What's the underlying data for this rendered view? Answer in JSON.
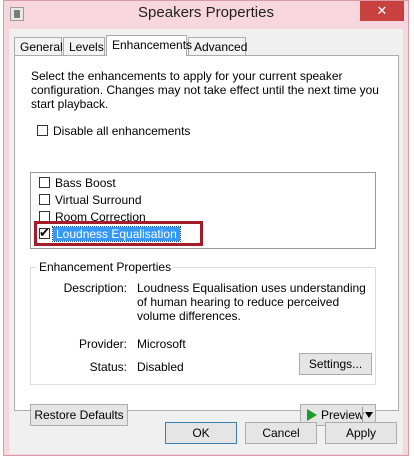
{
  "window": {
    "title": "Speakers Properties",
    "close_glyph": "✕"
  },
  "tabs": [
    {
      "label": "General"
    },
    {
      "label": "Levels"
    },
    {
      "label": "Enhancements"
    },
    {
      "label": "Advanced"
    }
  ],
  "enhancements": {
    "intro": "Select the enhancements to apply for your current speaker configuration. Changes may not take effect until the next time you start playback.",
    "disable_all_label": "Disable all enhancements",
    "disable_all_checked": false,
    "list": [
      {
        "label": "Bass Boost",
        "checked": false
      },
      {
        "label": "Virtual Surround",
        "checked": false
      },
      {
        "label": "Room Correction",
        "checked": false
      },
      {
        "label": "Loudness Equalisation",
        "checked": true,
        "selected": true
      }
    ],
    "highlight_color": "#a31c28"
  },
  "properties": {
    "group_title": "Enhancement Properties",
    "description_label": "Description:",
    "description_text": "Loudness Equalisation uses understanding of human hearing to reduce perceived volume differences.",
    "provider_label": "Provider:",
    "provider_value": "Microsoft",
    "status_label": "Status:",
    "status_value": "Disabled",
    "settings_button": "Settings..."
  },
  "buttons": {
    "restore_defaults": "Restore Defaults",
    "preview": "Preview",
    "ok": "OK",
    "cancel": "Cancel",
    "apply": "Apply"
  },
  "icons": {
    "app": "speaker-properties-icon",
    "play": "play-icon",
    "dropdown": "chevron-down-icon"
  },
  "colors": {
    "title_bar": "#f7d6de",
    "close_button": "#c7423f",
    "selection": "#3399ff",
    "play": "#1b9b2b"
  }
}
